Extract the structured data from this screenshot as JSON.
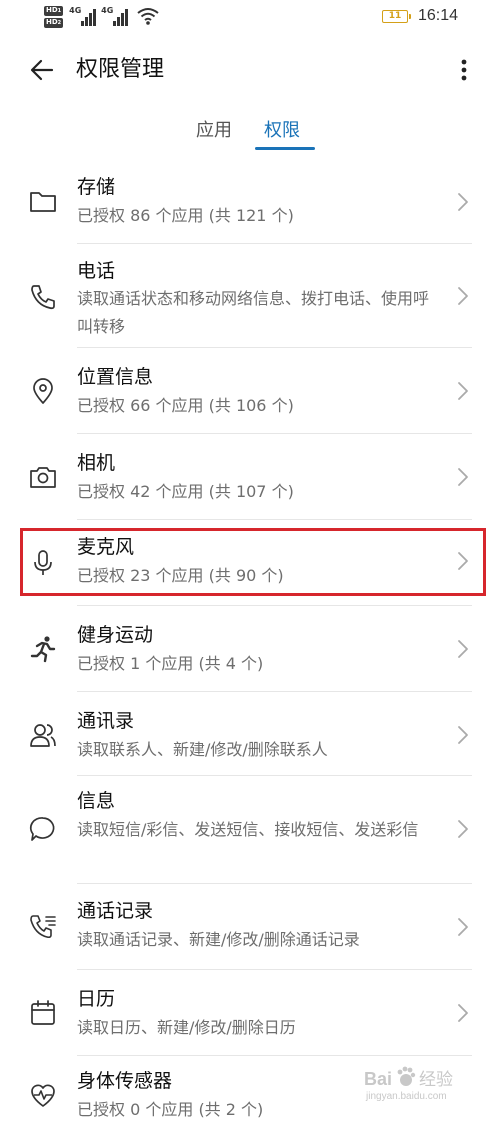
{
  "status_bar": {
    "hd1": "HD",
    "hd2": "HD",
    "net1": "4G",
    "net2": "4G",
    "battery_level": "11",
    "time": "16:14"
  },
  "header": {
    "title": "权限管理"
  },
  "tabs": [
    {
      "label": "应用",
      "active": false
    },
    {
      "label": "权限",
      "active": true
    }
  ],
  "permissions": [
    {
      "icon": "folder-icon",
      "title": "存储",
      "description": "已授权 86 个应用 (共 121 个)"
    },
    {
      "icon": "phone-icon",
      "title": "电话",
      "description": "读取通话状态和移动网络信息、拨打电话、使用呼叫转移"
    },
    {
      "icon": "location-pin-icon",
      "title": "位置信息",
      "description": "已授权 66 个应用 (共 106 个)"
    },
    {
      "icon": "camera-icon",
      "title": "相机",
      "description": "已授权 42 个应用 (共 107 个)"
    },
    {
      "icon": "microphone-icon",
      "title": "麦克风",
      "description": "已授权 23 个应用 (共 90 个)",
      "highlighted": true
    },
    {
      "icon": "running-person-icon",
      "title": "健身运动",
      "description": "已授权 1 个应用 (共 4 个)"
    },
    {
      "icon": "contacts-icon",
      "title": "通讯录",
      "description": "读取联系人、新建/修改/删除联系人"
    },
    {
      "icon": "message-bubble-icon",
      "title": "信息",
      "description": "读取短信/彩信、发送短信、接收短信、发送彩信"
    },
    {
      "icon": "call-log-icon",
      "title": "通话记录",
      "description": "读取通话记录、新建/修改/删除通话记录"
    },
    {
      "icon": "calendar-icon",
      "title": "日历",
      "description": "读取日历、新建/修改/删除日历"
    },
    {
      "icon": "heart-rate-icon",
      "title": "身体传感器",
      "description": "已授权 0 个应用 (共 2 个)"
    }
  ],
  "watermark": {
    "brand": "Bai",
    "brand_suffix": "经验",
    "url": "jingyan.baidu.com"
  },
  "colors": {
    "accent": "#1a73b8",
    "highlight": "#d6262c",
    "battery": "#d4a018"
  }
}
